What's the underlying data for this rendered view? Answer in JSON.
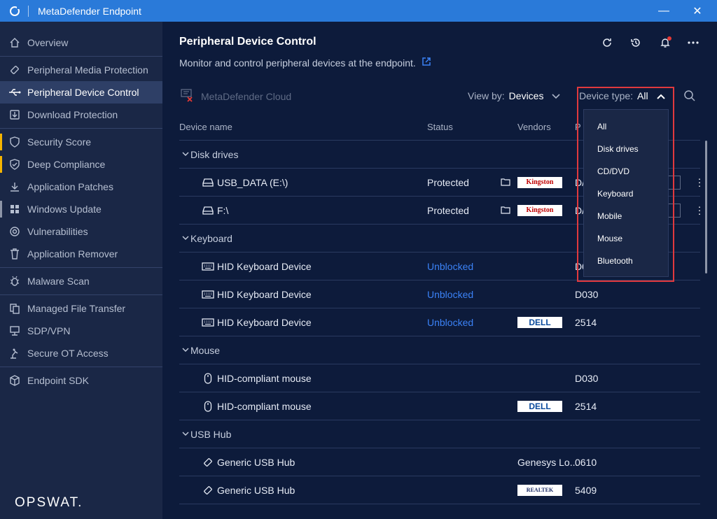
{
  "window": {
    "title": "MetaDefender Endpoint",
    "minimize_glyph": "—",
    "close_glyph": "✕"
  },
  "sidebar": {
    "items": [
      {
        "label": "Overview",
        "icon": "home-icon"
      },
      {
        "label": "Peripheral Media Protection",
        "icon": "usb-stick-icon"
      },
      {
        "label": "Peripheral Device Control",
        "icon": "usb-icon",
        "active": true
      },
      {
        "label": "Download Protection",
        "icon": "download-protection-icon"
      },
      {
        "label": "Security Score",
        "icon": "shield-icon",
        "marker": "warning"
      },
      {
        "label": "Deep Compliance",
        "icon": "check-shield-icon",
        "marker": "warning"
      },
      {
        "label": "Application Patches",
        "icon": "patch-download-icon"
      },
      {
        "label": "Windows Update",
        "icon": "windows-icon",
        "marker": "gray"
      },
      {
        "label": "Vulnerabilities",
        "icon": "vulnerability-icon"
      },
      {
        "label": "Application Remover",
        "icon": "trash-icon"
      },
      {
        "label": "Malware Scan",
        "icon": "bug-icon"
      },
      {
        "label": "Managed File Transfer",
        "icon": "file-transfer-icon"
      },
      {
        "label": "SDP/VPN",
        "icon": "network-icon"
      },
      {
        "label": "Secure OT Access",
        "icon": "robot-arm-icon"
      },
      {
        "label": "Endpoint SDK",
        "icon": "cube-icon"
      }
    ],
    "brand": "OPSWAT."
  },
  "main": {
    "title": "Peripheral Device Control",
    "subtitle": "Monitor and control peripheral devices at the endpoint.",
    "cloud_label": "MetaDefender Cloud",
    "view_by": {
      "label": "View by:",
      "value": "Devices"
    },
    "device_type": {
      "label": "Device type:",
      "value": "All"
    },
    "columns": {
      "name": "Device name",
      "status": "Status",
      "vendors": "Vendors",
      "product": "P"
    },
    "groups": [
      {
        "name": "Disk drives",
        "devices": [
          {
            "name": "USB_DATA (E:\\)",
            "icon": "drive-icon",
            "status": "Protected",
            "status_color": "white",
            "vendor_logo": "Kingston",
            "product": "D/",
            "has_folder": true,
            "has_menu": true
          },
          {
            "name": "F:\\",
            "icon": "drive-icon",
            "status": "Protected",
            "status_color": "white",
            "vendor_logo": "Kingston",
            "product": "D/",
            "has_folder": true,
            "has_menu": true
          }
        ]
      },
      {
        "name": "Keyboard",
        "devices": [
          {
            "name": "HID Keyboard Device",
            "icon": "keyboard-icon",
            "status": "Unblocked",
            "status_color": "blue",
            "product": "D0"
          },
          {
            "name": "HID Keyboard Device",
            "icon": "keyboard-icon",
            "status": "Unblocked",
            "status_color": "blue",
            "product": "D030"
          },
          {
            "name": "HID Keyboard Device",
            "icon": "keyboard-icon",
            "status": "Unblocked",
            "status_color": "blue",
            "vendor_logo": "DELL",
            "product": "2514"
          }
        ]
      },
      {
        "name": "Mouse",
        "devices": [
          {
            "name": "HID-compliant mouse",
            "icon": "mouse-icon",
            "product": "D030"
          },
          {
            "name": "HID-compliant mouse",
            "icon": "mouse-icon",
            "vendor_logo": "DELL",
            "product": "2514"
          }
        ]
      },
      {
        "name": "USB Hub",
        "devices": [
          {
            "name": "Generic USB Hub",
            "icon": "usb-hub-icon",
            "vendor_text": "Genesys Lo...",
            "product": "0610"
          },
          {
            "name": "Generic USB Hub",
            "icon": "usb-hub-icon",
            "vendor_logo": "REALTEK",
            "product": "5409"
          }
        ]
      }
    ]
  },
  "device_type_menu": {
    "options": [
      "All",
      "Disk drives",
      "CD/DVD",
      "Keyboard",
      "Mobile",
      "Mouse",
      "Bluetooth"
    ]
  },
  "colors": {
    "titlebar": "#2a7ad9",
    "background": "#0d1b3b",
    "sidebar": "#1a2746",
    "accent_blue": "#3b82f6",
    "warning": "#f5b400",
    "highlight": "#e0393e"
  }
}
